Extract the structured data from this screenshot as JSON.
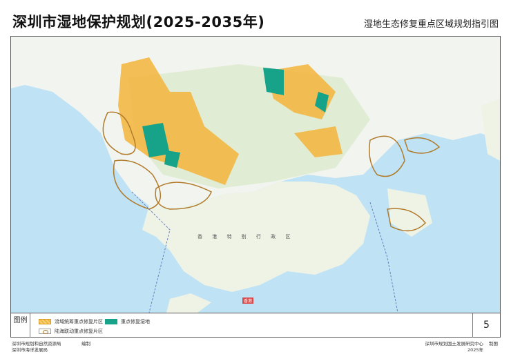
{
  "header": {
    "title": "深圳市湿地保护规划(2025-2035年)",
    "subtitle": "湿地生态修复重点区域规划指引图"
  },
  "map": {
    "region_label": "香 港 特 别 行 政 区",
    "hk_label": "香港"
  },
  "legend": {
    "title": "图例",
    "items": [
      {
        "label": "流域统筹重点修复片区",
        "color": "#f3b43a"
      },
      {
        "label": "重点修复湿地",
        "color": "#17a38a"
      },
      {
        "label": "陆海联动重点修复片区",
        "color": "#b07a2a"
      }
    ],
    "page_number": "5"
  },
  "footer": {
    "org1": "深圳市规划和自然资源局",
    "org2": "深圳市海洋发展局",
    "compiled": "编制",
    "mapper": "深圳市规划国土发展研究中心",
    "drawn": "制图",
    "year": "2025年"
  }
}
